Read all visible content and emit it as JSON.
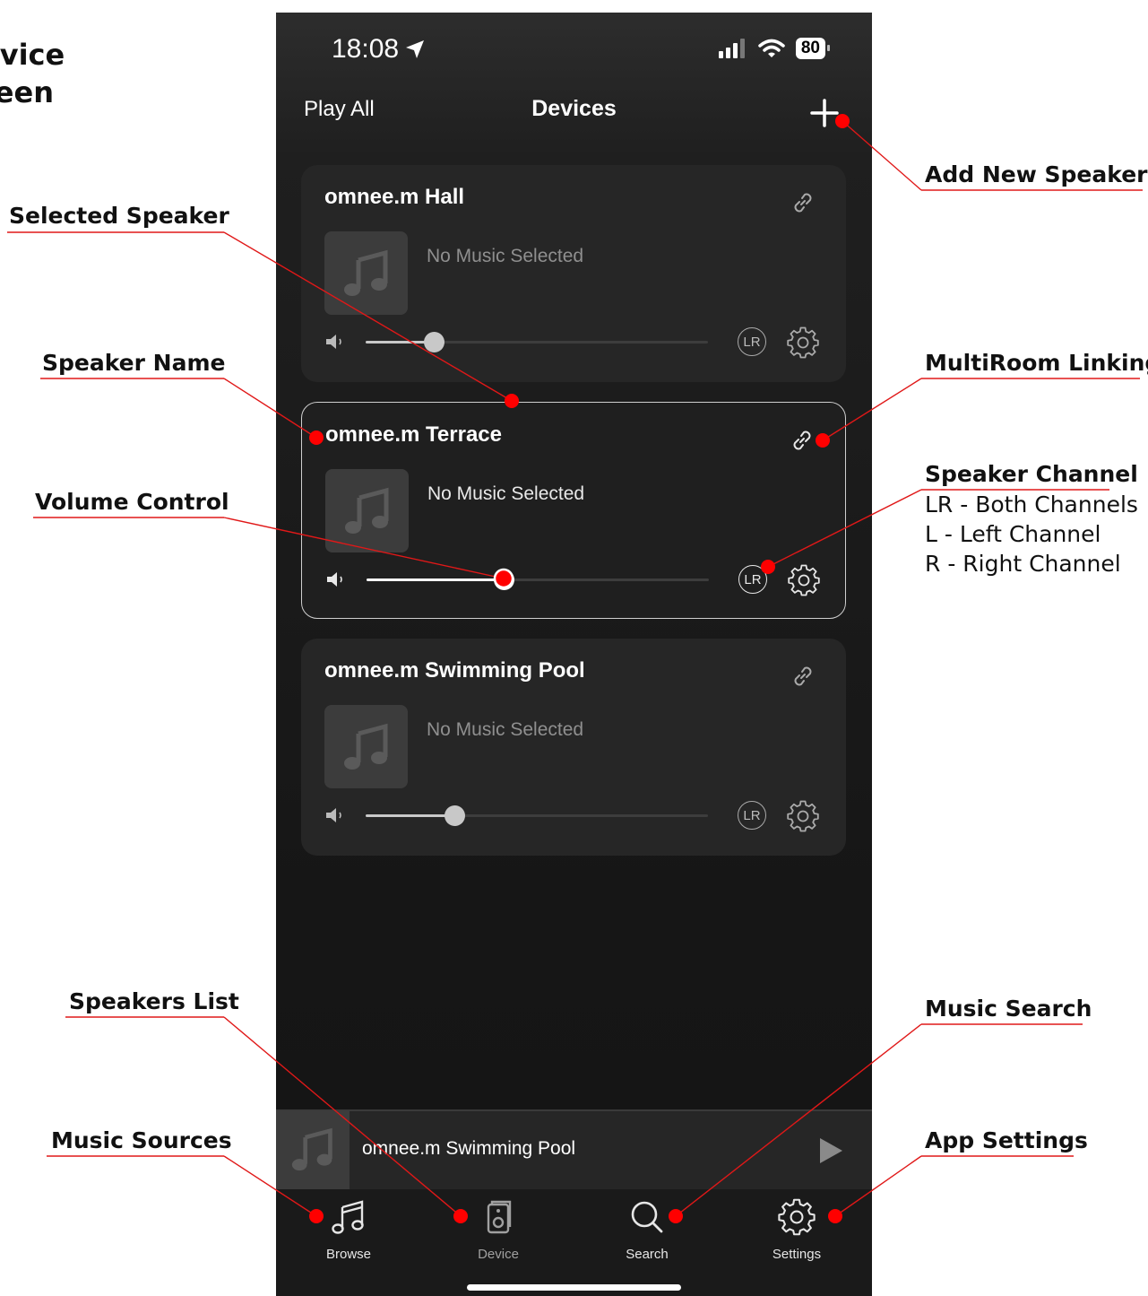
{
  "page_title": [
    "evice",
    "reen"
  ],
  "status_bar": {
    "time": "18:08",
    "battery": "80"
  },
  "nav": {
    "left": "Play All",
    "title": "Devices"
  },
  "devices": [
    {
      "name": "omnee.m Hall",
      "now_playing": "No Music Selected",
      "volume": 0.2,
      "channel": "LR",
      "selected": false
    },
    {
      "name": "omnee.m Terrace",
      "now_playing": "No Music Selected",
      "volume": 0.4,
      "channel": "LR",
      "selected": true
    },
    {
      "name": "omnee.m Swimming Pool",
      "now_playing": "No Music Selected",
      "volume": 0.26,
      "channel": "LR",
      "selected": false
    }
  ],
  "mini_player": {
    "title": "omnee.m Swimming Pool"
  },
  "tabs": [
    {
      "label": "Browse",
      "icon": "music-note-icon",
      "active": false
    },
    {
      "label": "Device",
      "icon": "speaker-icon",
      "active": true
    },
    {
      "label": "Search",
      "icon": "search-icon",
      "active": false
    },
    {
      "label": "Settings",
      "icon": "gear-icon",
      "active": false
    }
  ],
  "annotations": {
    "add_new_speaker": "Add New Speaker",
    "selected_speaker": "Selected Speaker",
    "speaker_name": "Speaker Name",
    "multiroom_linking": "MultiRoom Linking",
    "speaker_channel": "Speaker Channel",
    "channel_options": [
      "LR - Both Channels",
      "L - Left Channel",
      "R - Right Channel"
    ],
    "volume_control": "Volume Control",
    "speakers_list": "Speakers List",
    "music_search": "Music Search",
    "music_sources": "Music Sources",
    "app_settings": "App Settings"
  },
  "colors": {
    "annotation_dot": "#ff0000",
    "annotation_line": "#e01818",
    "app_background": "#1a1a1a",
    "card_background": "#262626"
  }
}
